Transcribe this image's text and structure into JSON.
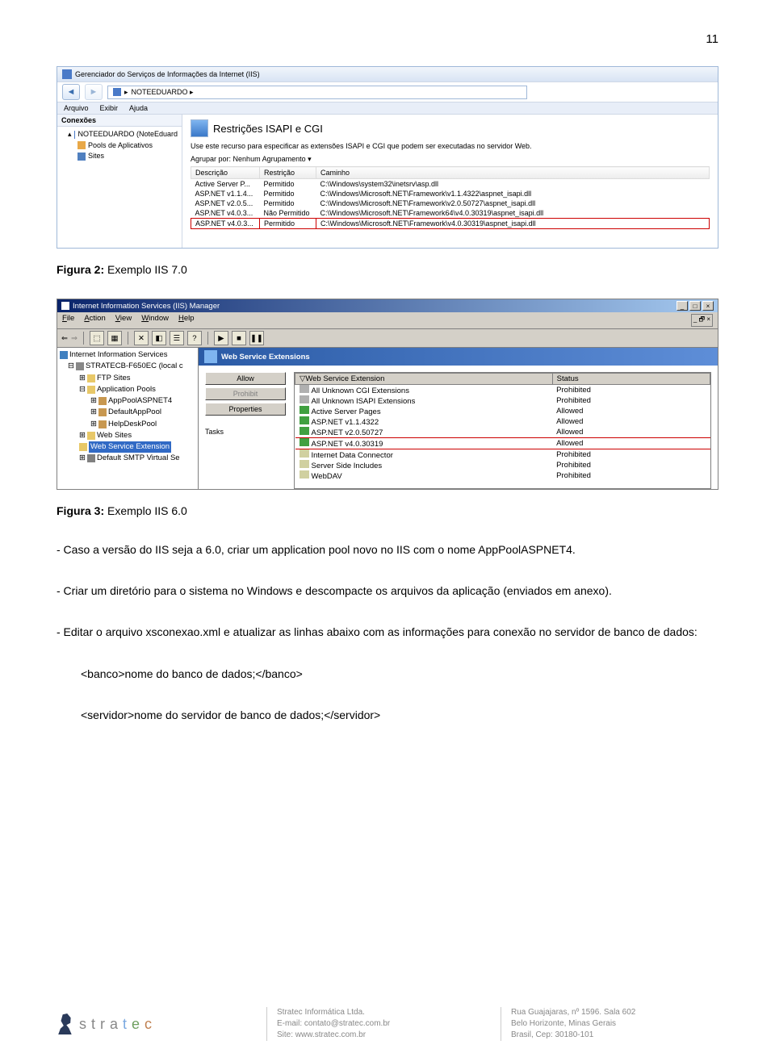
{
  "page_number": "11",
  "fig1": {
    "window_title": "Gerenciador do Serviços de Informações da Internet (IIS)",
    "breadcrumb": "NOTEEDUARDO  ▸",
    "menu": [
      "Arquivo",
      "Exibir",
      "Ajuda"
    ],
    "sidebar_title": "Conexões",
    "tree": {
      "root": "NOTEEDUARDO (NoteEduard",
      "child1": "Pools de Aplicativos",
      "child2": "Sites"
    },
    "main_title": "Restrições ISAPI e CGI",
    "main_desc": "Use este recurso para especificar as extensões ISAPI e CGI que podem ser executadas no servidor Web.",
    "group_by_label": "Agrupar por:",
    "group_by_value": "Nenhum Agrupamento",
    "columns": [
      "Descrição",
      "Restrição",
      "Caminho"
    ],
    "rows": [
      {
        "d": "Active Server P...",
        "r": "Permitido",
        "c": "C:\\Windows\\system32\\inetsrv\\asp.dll"
      },
      {
        "d": "ASP.NET v1.1.4...",
        "r": "Permitido",
        "c": "C:\\Windows\\Microsoft.NET\\Framework\\v1.1.4322\\aspnet_isapi.dll"
      },
      {
        "d": "ASP.NET v2.0.5...",
        "r": "Permitido",
        "c": "C:\\Windows\\Microsoft.NET\\Framework\\v2.0.50727\\aspnet_isapi.dll"
      },
      {
        "d": "ASP.NET v4.0.3...",
        "r": "Não Permitido",
        "c": "C:\\Windows\\Microsoft.NET\\Framework64\\v4.0.30319\\aspnet_isapi.dll"
      },
      {
        "d": "ASP.NET v4.0.3...",
        "r": "Permitido",
        "c": "C:\\Windows\\Microsoft.NET\\Framework\\v4.0.30319\\aspnet_isapi.dll"
      }
    ]
  },
  "caption1": {
    "bold": "Figura 2:",
    "text": " Exemplo IIS 7.0"
  },
  "fig2": {
    "window_title": "Internet Information Services (IIS) Manager",
    "menu": [
      "File",
      "Action",
      "View",
      "Window",
      "Help"
    ],
    "tree": {
      "root": "Internet Information Services",
      "server": "STRATECB-F650EC (local c",
      "ftp": "FTP Sites",
      "apppools": "Application Pools",
      "ap1": "AppPoolASPNET4",
      "ap2": "DefaultAppPool",
      "ap3": "HelpDeskPool",
      "websites": "Web Sites",
      "wse": "Web Service Extension",
      "smtp": "Default SMTP Virtual Se"
    },
    "main_title": "Web Service Extensions",
    "buttons": {
      "allow": "Allow",
      "prohibit": "Prohibit",
      "props": "Properties"
    },
    "tasks_label": "Tasks",
    "columns": [
      "Web Service Extension",
      "Status"
    ],
    "rows": [
      {
        "i": "#b0b0b0",
        "e": "All Unknown CGI Extensions",
        "s": "Prohibited"
      },
      {
        "i": "#b0b0b0",
        "e": "All Unknown ISAPI Extensions",
        "s": "Prohibited"
      },
      {
        "i": "#40a040",
        "e": "Active Server Pages",
        "s": "Allowed"
      },
      {
        "i": "#40a040",
        "e": "ASP.NET v1.1.4322",
        "s": "Allowed"
      },
      {
        "i": "#40a040",
        "e": "ASP.NET v2.0.50727",
        "s": "Allowed"
      },
      {
        "i": "#40a040",
        "e": "ASP.NET v4.0.30319",
        "s": "Allowed"
      },
      {
        "i": "#d0d0a0",
        "e": "Internet Data Connector",
        "s": "Prohibited"
      },
      {
        "i": "#d0d0a0",
        "e": "Server Side Includes",
        "s": "Prohibited"
      },
      {
        "i": "#d0d0a0",
        "e": "WebDAV",
        "s": "Prohibited"
      }
    ]
  },
  "caption2": {
    "bold": "Figura 3:",
    "text": " Exemplo IIS 6.0"
  },
  "body": {
    "p1": "- Caso a versão do IIS seja a 6.0, criar um application pool novo no IIS com o nome AppPoolASPNET4.",
    "p2": "- Criar um diretório para o sistema no Windows e descompacte os arquivos da aplicação (enviados em anexo).",
    "p3": "- Editar o arquivo xsconexao.xml e atualizar as linhas abaixo com as informações para conexão no servidor de banco de dados:",
    "code1": "<banco>nome do banco de dados;</banco>",
    "code2": "<servidor>nome do servidor de banco de dados;</servidor>"
  },
  "footer": {
    "company": "Stratec Informática Ltda.",
    "email_label": "E-mail: ",
    "email": "contato@stratec.com.br",
    "site_label": "Site: ",
    "site": "www.stratec.com.br",
    "addr1": "Rua Guajajaras, nº 1596. Sala 602",
    "addr2": "Belo Horizonte, Minas Gerais",
    "addr3": "Brasil, Cep: 30180-101"
  }
}
